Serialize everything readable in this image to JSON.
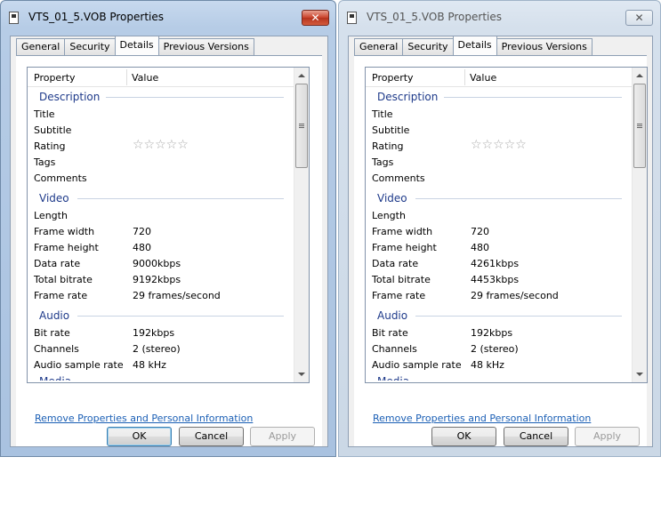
{
  "dialogs": [
    {
      "title": "VTS_01_5.VOB Properties",
      "close_glyph": "✕",
      "tabs": [
        "General",
        "Security",
        "Details",
        "Previous Versions"
      ],
      "active_tab": "Details",
      "columns": {
        "property": "Property",
        "value": "Value"
      },
      "groups": {
        "description": "Description",
        "video": "Video",
        "audio": "Audio",
        "next_partial": "Media"
      },
      "rows": {
        "title": {
          "label": "Title",
          "value": ""
        },
        "subtitle": {
          "label": "Subtitle",
          "value": ""
        },
        "rating": {
          "label": "Rating",
          "stars": "☆☆☆☆☆"
        },
        "tags": {
          "label": "Tags",
          "value": ""
        },
        "comments": {
          "label": "Comments",
          "value": ""
        },
        "length": {
          "label": "Length",
          "value": ""
        },
        "frame_width": {
          "label": "Frame width",
          "value": "720"
        },
        "frame_height": {
          "label": "Frame height",
          "value": "480"
        },
        "data_rate": {
          "label": "Data rate",
          "value": "9000kbps"
        },
        "total_bitrate": {
          "label": "Total bitrate",
          "value": "9192kbps"
        },
        "frame_rate": {
          "label": "Frame rate",
          "value": "29 frames/second"
        },
        "bit_rate": {
          "label": "Bit rate",
          "value": "192kbps"
        },
        "channels": {
          "label": "Channels",
          "value": "2 (stereo)"
        },
        "sample_rate": {
          "label": "Audio sample rate",
          "value": "48 kHz"
        }
      },
      "link": "Remove Properties and Personal Information",
      "buttons": {
        "ok": "OK",
        "cancel": "Cancel",
        "apply": "Apply"
      }
    },
    {
      "title": "VTS_01_5.VOB Properties",
      "close_glyph": "✕",
      "tabs": [
        "General",
        "Security",
        "Details",
        "Previous Versions"
      ],
      "active_tab": "Details",
      "columns": {
        "property": "Property",
        "value": "Value"
      },
      "groups": {
        "description": "Description",
        "video": "Video",
        "audio": "Audio",
        "next_partial": "Media"
      },
      "rows": {
        "title": {
          "label": "Title",
          "value": ""
        },
        "subtitle": {
          "label": "Subtitle",
          "value": ""
        },
        "rating": {
          "label": "Rating",
          "stars": "☆☆☆☆☆"
        },
        "tags": {
          "label": "Tags",
          "value": ""
        },
        "comments": {
          "label": "Comments",
          "value": ""
        },
        "length": {
          "label": "Length",
          "value": ""
        },
        "frame_width": {
          "label": "Frame width",
          "value": "720"
        },
        "frame_height": {
          "label": "Frame height",
          "value": "480"
        },
        "data_rate": {
          "label": "Data rate",
          "value": "4261kbps"
        },
        "total_bitrate": {
          "label": "Total bitrate",
          "value": "4453kbps"
        },
        "frame_rate": {
          "label": "Frame rate",
          "value": "29 frames/second"
        },
        "bit_rate": {
          "label": "Bit rate",
          "value": "192kbps"
        },
        "channels": {
          "label": "Channels",
          "value": "2 (stereo)"
        },
        "sample_rate": {
          "label": "Audio sample rate",
          "value": "48 kHz"
        }
      },
      "link": "Remove Properties and Personal Information",
      "buttons": {
        "ok": "OK",
        "cancel": "Cancel",
        "apply": "Apply"
      }
    }
  ]
}
